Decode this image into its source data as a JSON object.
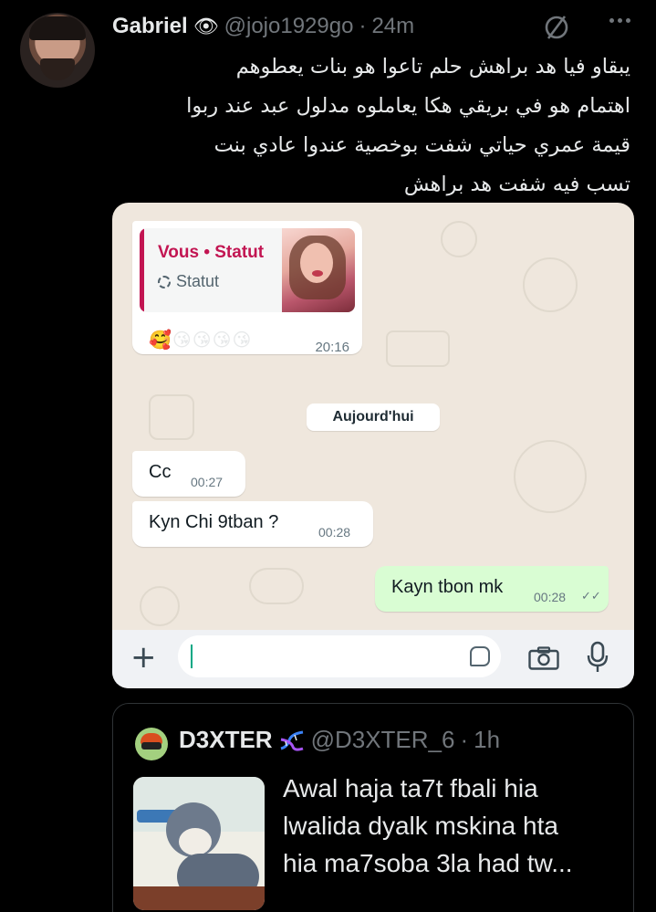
{
  "tweet": {
    "author_name": "Gabriel",
    "name_emoji": "👁",
    "handle": "@jojo1929go",
    "separator": "·",
    "time": "24m",
    "text": "يبقاو فيا هد براهش حلم تاعوا هو بنات يعطوهم\nاهتمام هو في بريقي هكا يعاملوه مدلول عبد عند ربوا\nقيمة عمري حياتي شفت بوخصية عندوا عادي بنت\nتسب فيه شفت هد براهش"
  },
  "chat": {
    "status_reply": {
      "title": "Vous • Statut",
      "subtitle": "Statut",
      "emojis": "🥰😘😘😘😘",
      "time": "20:16"
    },
    "date_chip": "Aujourd'hui",
    "messages": [
      {
        "direction": "in",
        "text": "Cc",
        "time": "00:27"
      },
      {
        "direction": "in",
        "text": "Kyn Chi 9tban ?",
        "time": "00:28"
      },
      {
        "direction": "out",
        "text": "Kayn tbon mk",
        "time": "00:28",
        "ticks": "✓✓"
      }
    ],
    "composer": {
      "plus": "+",
      "placeholder": ""
    }
  },
  "quote": {
    "author_name": "D3XTER",
    "handle": "@D3XTER_6",
    "separator": "·",
    "time": "1h",
    "text": "Awal haja ta7t fbali hia\nlwalida dyalk mskina hta\nhia ma7soba 3la had tw..."
  },
  "colors": {
    "background": "#000000",
    "chat_wallpaper": "#efe7dd",
    "outgoing_bubble": "#d9fdd3",
    "status_accent": "#c21552",
    "secondary_text": "#71767b"
  },
  "icons": [
    "eye-emoji",
    "grok-icon",
    "more-icon",
    "status-ring-icon",
    "plus-icon",
    "sticker-icon",
    "camera-icon",
    "mic-icon",
    "dna-icon",
    "double-check-icon"
  ]
}
